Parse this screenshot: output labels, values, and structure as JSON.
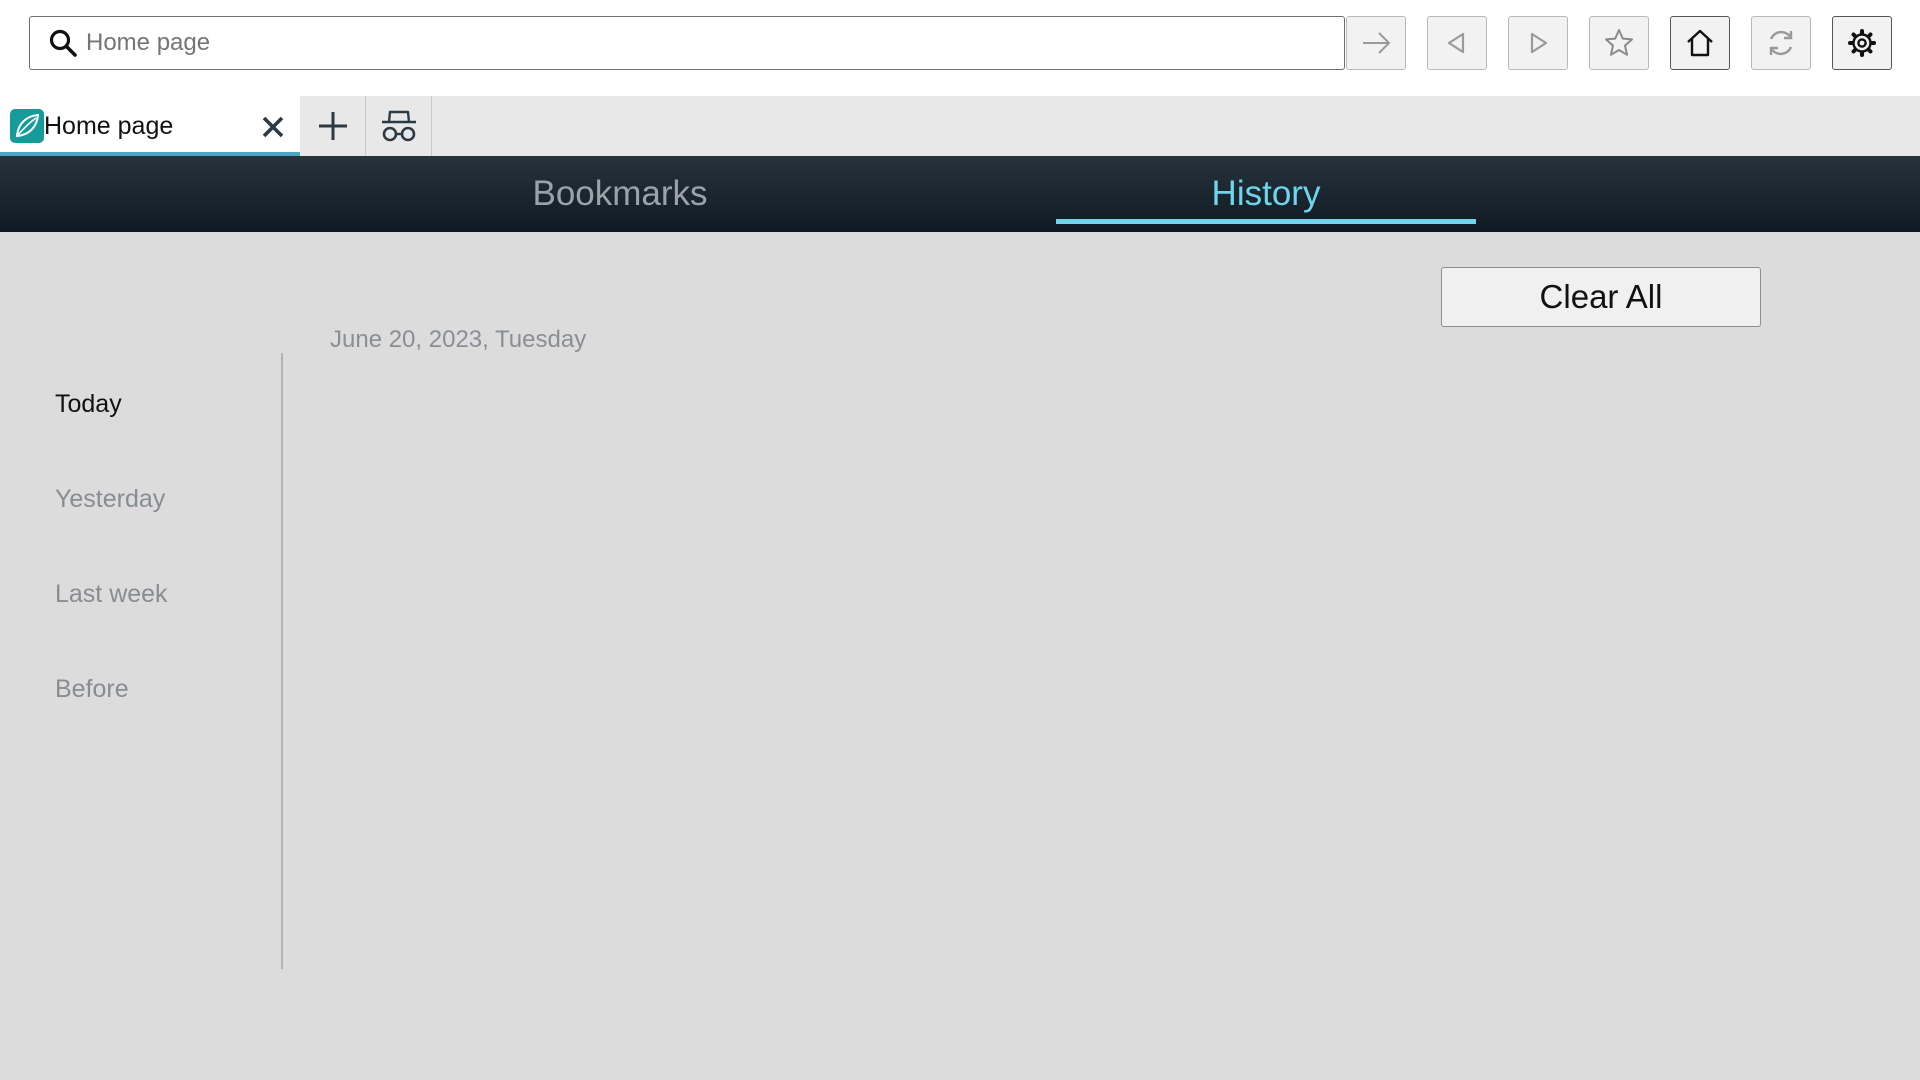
{
  "toolbar": {
    "address": {
      "value": "",
      "placeholder": "Home page"
    },
    "buttons": [
      "go",
      "back",
      "forward",
      "bookmark",
      "home",
      "refresh",
      "settings"
    ]
  },
  "tabs": [
    {
      "title": "Home page",
      "favicon": "app-logo-icon",
      "active": true
    }
  ],
  "nav": {
    "tabs": [
      {
        "label": "Bookmarks",
        "active": false
      },
      {
        "label": "History",
        "active": true
      }
    ]
  },
  "history": {
    "clear_label": "Clear All",
    "date_heading": "June 20, 2023, Tuesday",
    "periods": [
      {
        "label": "Today",
        "selected": true
      },
      {
        "label": "Yesterday",
        "selected": false
      },
      {
        "label": "Last week",
        "selected": false
      },
      {
        "label": "Before",
        "selected": false
      }
    ]
  },
  "colors": {
    "accent": "#6fd4ec",
    "navbar": "#1b2730",
    "favicon": "#169b9b",
    "background": "#dcdcdc"
  }
}
